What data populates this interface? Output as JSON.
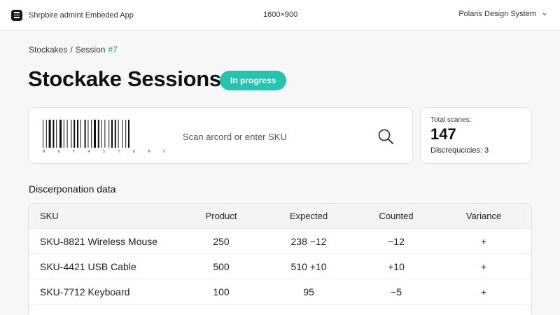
{
  "topbar": {
    "app_title": "Shrpbire admint Embeded App",
    "resolution": "1600×900",
    "design_system": "Polaris Design System"
  },
  "breadcrumb": {
    "parent": "Stockakes",
    "separator": "/",
    "current": "Session",
    "session_id": "#7"
  },
  "page": {
    "title": "Stockake Sessions",
    "status": "In progress"
  },
  "scan": {
    "barcode_digits": [
      "M",
      "0",
      "F",
      "4",
      "5",
      "7",
      "8",
      "M",
      "V"
    ],
    "placeholder": "Scan arcord or enter SKU",
    "search_icon": "search-icon"
  },
  "stats": {
    "total_label": "Total scanes:",
    "total_value": "147",
    "disc_label": "Discrequcicies:",
    "disc_value": "3"
  },
  "section_title": "Discerponation data",
  "table": {
    "columns": [
      "SKU",
      "Product",
      "Expected",
      "Counted",
      "Variance"
    ],
    "rows": [
      {
        "sku": "SKU-8821 Wireless Mouse",
        "product": "250",
        "expected": "238  −12",
        "counted": "−12",
        "variance": "+"
      },
      {
        "sku": "SKU-4421 USB Cable",
        "product": "500",
        "expected": "510 +10",
        "counted": "+10",
        "variance": "+"
      },
      {
        "sku": "SKU-7712 Keyboard",
        "product": "100",
        "expected": "95",
        "counted": "−5",
        "variance": "+"
      }
    ]
  },
  "colors": {
    "accent": "#26c3b0",
    "accent_text": "#1aa38f"
  }
}
